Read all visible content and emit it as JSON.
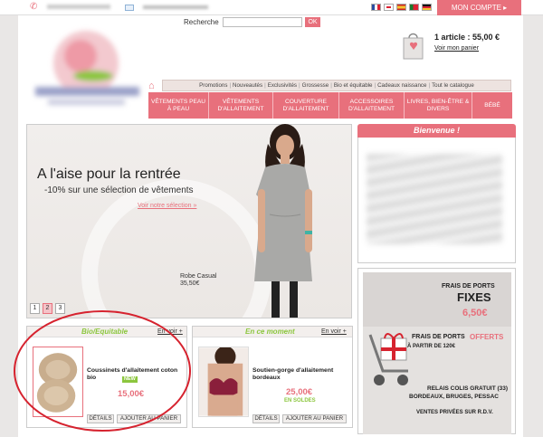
{
  "header": {
    "lang_flags": [
      "fr",
      "en",
      "es",
      "pt",
      "de"
    ],
    "account_label": "MON COMPTE ▸",
    "search_label": "Recherche",
    "search_value": "",
    "search_button": "OK",
    "cart_summary": "1 article : 55,00 €",
    "cart_link": "Voir mon panier"
  },
  "subnav": [
    "Promotions",
    "Nouveautés",
    "Exclusivités",
    "Grossesse",
    "Bio et équitable",
    "Cadeaux naissance",
    "Tout le catalogue"
  ],
  "mainnav": [
    {
      "label": "VÊTEMENTS PEAU À PEAU",
      "width": 67
    },
    {
      "label": "VÊTEMENTS D'ALLAITEMENT",
      "width": 71
    },
    {
      "label": "COUVERTURE D'ALLAITEMENT",
      "width": 73
    },
    {
      "label": "ACCESSOIRES D'ALLAITEMENT",
      "width": 72
    },
    {
      "label": "LIVRES, BIEN-ÊTRE & DIVERS",
      "width": 75
    },
    {
      "label": "BÉBÉ",
      "width": 44
    }
  ],
  "banner": {
    "headline": "A l'aise pour la rentrée",
    "subline": "-10% sur une sélection de vêtements",
    "link": "Voir notre sélection »",
    "product_label": "Robe Casual",
    "product_price": "35,50€",
    "pages": [
      "1",
      "2",
      "3"
    ],
    "active_page": 2
  },
  "welcome": {
    "title": "Bienvenue !"
  },
  "shipping": {
    "title1": "FRAIS DE PORTS",
    "fixes": "FIXES",
    "price": "6,50€",
    "title2": "FRAIS DE PORTS",
    "offerts": "OFFERTS",
    "threshold": "À PARTIR DE 120€",
    "relais1": "RELAIS COLIS GRATUIT (33)",
    "relais2": "BORDEAUX, BRUGES, PESSAC",
    "ventes": "VENTES PRIVÉES SUR R.D.V."
  },
  "card_bio": {
    "title": "Bio/Equitable",
    "voir": "En voir +",
    "product": "Coussinets d'allaitement coton bio",
    "badge": "NEW",
    "price": "15,00€",
    "details": "DÉTAILS",
    "add": "AJOUTER AU PANIER"
  },
  "card_moment": {
    "title": "En ce moment",
    "voir": "En voir +",
    "product": "Soutien-gorge d'allaitement bordeaux",
    "price": "25,00€",
    "soldes": "EN SOLDES",
    "details": "DÉTAILS",
    "add": "AJOUTER AU PANIER"
  },
  "colors": {
    "accent": "#e8707c",
    "green": "#8cc63e",
    "annotation": "#d6232f"
  }
}
